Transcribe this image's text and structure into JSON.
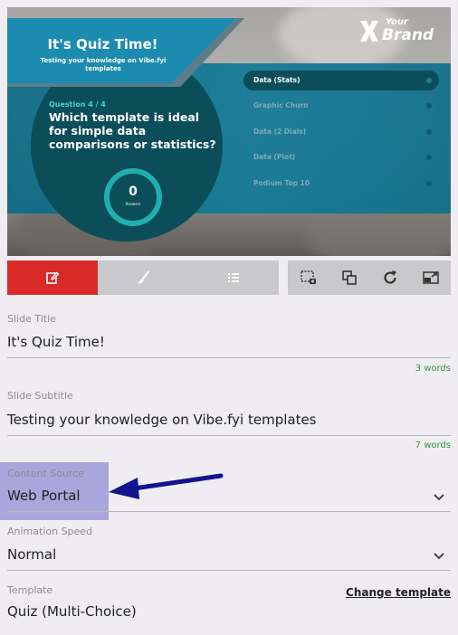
{
  "slide_preview": {
    "title": "It's Quiz Time!",
    "subtitle": "Testing your knowledge on Vibe.fyi templates",
    "question_number": "Question 4 / 4",
    "question": "Which template is ideal for simple data comparisons or statistics?",
    "score_value": "0",
    "score_label": "Answers",
    "answers": [
      {
        "label": "Data (Stats)",
        "selected": true
      },
      {
        "label": "Graphic Churn",
        "selected": false
      },
      {
        "label": "Data (2 Dials)",
        "selected": false
      },
      {
        "label": "Data (Plot)",
        "selected": false
      },
      {
        "label": "Podium Top 10",
        "selected": false
      }
    ],
    "brand_top": "Your",
    "brand_name": "Brand"
  },
  "toolbar": {
    "tabs": [
      {
        "name": "edit",
        "icon": "edit-icon",
        "active": true
      },
      {
        "name": "style",
        "icon": "brush-icon",
        "active": false
      },
      {
        "name": "list",
        "icon": "list-icon",
        "active": false
      }
    ],
    "actions": [
      {
        "icon": "screenshot-icon"
      },
      {
        "icon": "copy-icon"
      },
      {
        "icon": "refresh-icon"
      },
      {
        "icon": "popout-icon"
      }
    ]
  },
  "form": {
    "slide_title": {
      "label": "Slide Title",
      "value": "It's Quiz Time!",
      "count": "3 words"
    },
    "slide_subtitle": {
      "label": "Slide Subtitle",
      "value": "Testing your knowledge on Vibe.fyi templates",
      "count": "7 words"
    },
    "content_source": {
      "label": "Content Source",
      "value": "Web Portal"
    },
    "animation_speed": {
      "label": "Animation Speed",
      "value": "Normal"
    },
    "template": {
      "label": "Template",
      "value": "Quiz (Multi-Choice)",
      "link": "Change template"
    }
  },
  "colors": {
    "accent_red": "#da2a27",
    "word_count_green": "#3a9a3a",
    "highlight_purple": "#a9a6dc",
    "arrow_blue": "#12138f"
  }
}
